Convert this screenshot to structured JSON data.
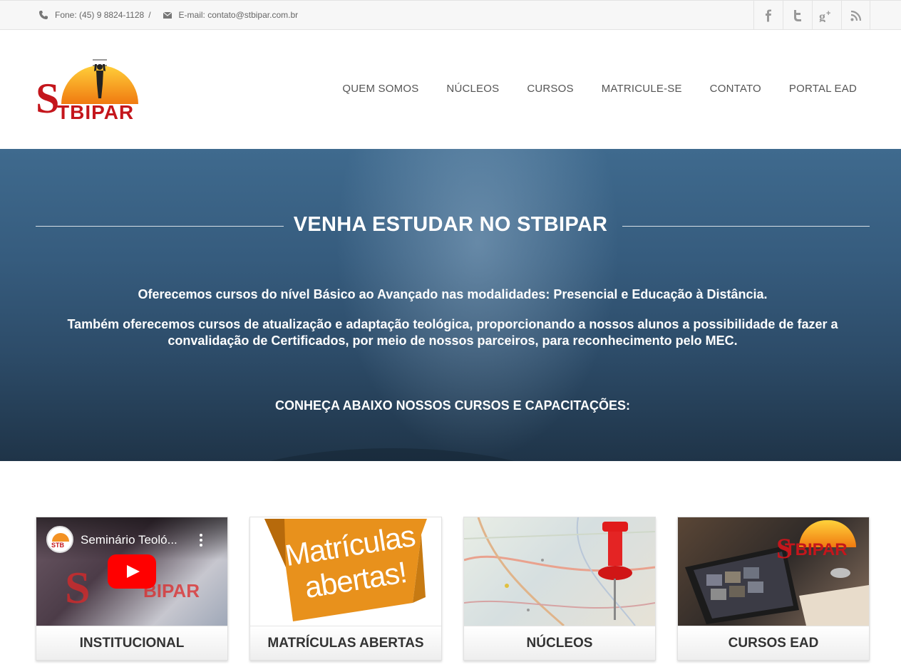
{
  "topbar": {
    "phone": "Fone: (45) 9 8824-1128",
    "separator": "/",
    "email": "E-mail: contato@stbipar.com.br",
    "social": [
      "facebook-icon",
      "twitter-icon",
      "google-plus-icon",
      "rss-icon"
    ]
  },
  "header": {
    "logo_text_s": "S",
    "logo_text_rest": "TBIPAR",
    "nav": [
      "QUEM SOMOS",
      "NÚCLEOS",
      "CURSOS",
      "MATRICULE-SE",
      "CONTATO",
      "PORTAL EAD"
    ]
  },
  "hero": {
    "title": "VENHA ESTUDAR NO STBIPAR",
    "paragraph1": "Oferecemos cursos do nível Básico ao Avançado nas modalidades: Presencial e Educação à Distância.",
    "paragraph2": "Também oferecemos cursos de atualização e adaptação teológica, proporcionando a nossos alunos a possibilidade de fazer a convalidação de Certificados, por meio de nossos parceiros, para reconhecimento pelo MEC.",
    "paragraph3": "CONHEÇA ABAIXO NOSSOS CURSOS E CAPACITAÇÕES:"
  },
  "cards": [
    {
      "label": "INSTITUCIONAL",
      "video_title": "Seminário Teoló..."
    },
    {
      "label": "MATRÍCULAS ABERTAS",
      "image_text_1": "Matrículas",
      "image_text_2": "abertas!"
    },
    {
      "label": "NÚCLEOS"
    },
    {
      "label": "CURSOS EAD"
    }
  ],
  "colors": {
    "brand_red": "#c4161c",
    "brand_orange": "#f7941d",
    "youtube_red": "#ff0000"
  }
}
